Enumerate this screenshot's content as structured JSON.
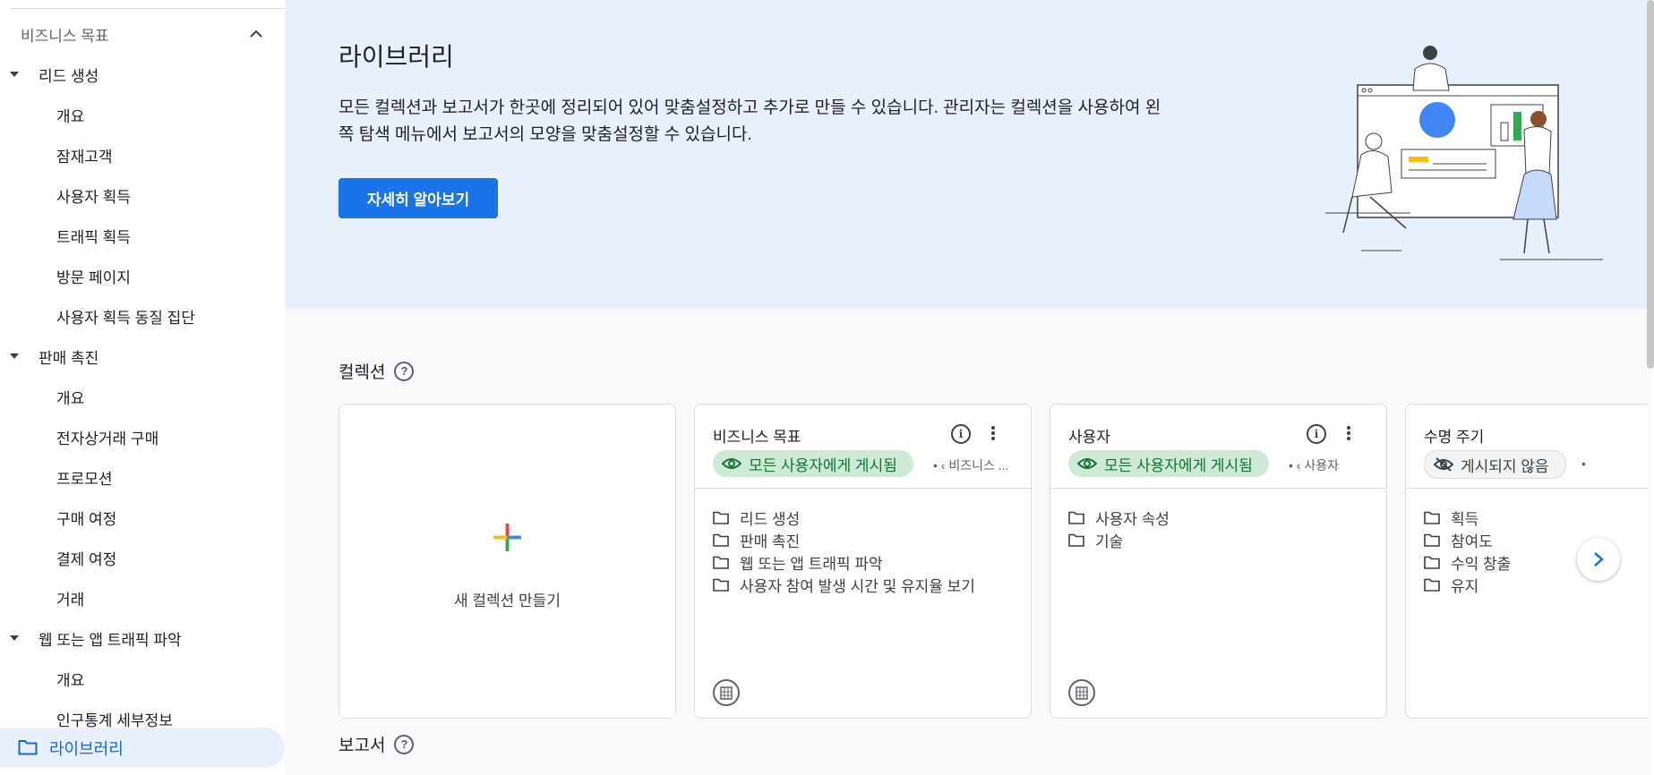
{
  "sidebar": {
    "section_title": "비즈니스 목표",
    "groups": [
      {
        "label": "리드 생성",
        "items": [
          "개요",
          "잠재고객",
          "사용자 획득",
          "트래픽 획득",
          "방문 페이지",
          "사용자 획득 동질 집단"
        ]
      },
      {
        "label": "판매 촉진",
        "items": [
          "개요",
          "전자상거래 구매",
          "프로모션",
          "구매 여정",
          "결제 여정",
          "거래"
        ]
      },
      {
        "label": "웹 또는 앱 트래픽 파악",
        "items": [
          "개요",
          "인구통계 세부정보"
        ]
      }
    ],
    "library_label": "라이브러리"
  },
  "hero": {
    "title": "라이브러리",
    "description": "모든 컬렉션과 보고서가 한곳에 정리되어 있어 맞춤설정하고 추가로 만들 수 있습니다. 관리자는 컬렉션을 사용하여 왼쪽 탐색 메뉴에서 보고서의 모양을 맞춤설정할 수 있습니다.",
    "button": "자세히 알아보기"
  },
  "collections": {
    "heading": "컬렉션",
    "new_label": "새 컬렉션 만들기",
    "cards": [
      {
        "title": "비즈니스 목표",
        "status": "모든 사용자에게 게시됨",
        "meta": "• ‹ 비즈니스 ...",
        "items": [
          "리드 생성",
          "판매 촉진",
          "웹 또는 앱 트래픽 파악",
          "사용자 참여 발생 시간 및 유지율 보기"
        ]
      },
      {
        "title": "사용자",
        "status": "모든 사용자에게 게시됨",
        "meta": "• ‹ 사용자",
        "items": [
          "사용자 속성",
          "기술"
        ]
      },
      {
        "title": "수명 주기",
        "status": "게시되지 않음",
        "meta": "•",
        "items": [
          "획득",
          "참여도",
          "수익 창출",
          "유지"
        ]
      }
    ]
  },
  "reports": {
    "heading": "보고서"
  },
  "icons": [
    "folder-icon",
    "help-icon",
    "info-icon",
    "more-vert-icon",
    "eye-icon",
    "eye-off-icon",
    "plus-icon",
    "building-icon",
    "chevron-right-icon",
    "chevron-up-icon",
    "caret-down-icon"
  ],
  "colors": {
    "accent": "#1a73e8",
    "hero_bg": "#e8f0fe",
    "published_bg": "#ceead6",
    "published_text": "#137333"
  }
}
